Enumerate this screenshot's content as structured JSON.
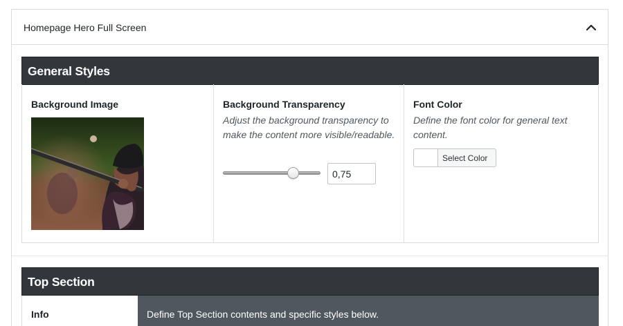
{
  "panel": {
    "title": "Homepage Hero Full Screen",
    "toggle_icon": "chevron-up-icon"
  },
  "general_styles": {
    "heading": "General Styles",
    "background_image": {
      "label": "Background Image",
      "image_description": "baseball-player-batting-photo"
    },
    "background_transparency": {
      "label": "Background Transparency",
      "description": "Adjust the background transparency to make the content more visible/readable.",
      "value": "0,75",
      "slider_fraction": 0.75
    },
    "font_color": {
      "label": "Font Color",
      "description": "Define the font color for general text content.",
      "button_label": "Select Color",
      "current_color": "#ffffff"
    }
  },
  "top_section": {
    "heading": "Top Section",
    "info_label": "Info",
    "info_text": "Define Top Section contents and specific styles below."
  },
  "colors": {
    "section_bar": "#32373c",
    "info_background": "#50575e"
  }
}
